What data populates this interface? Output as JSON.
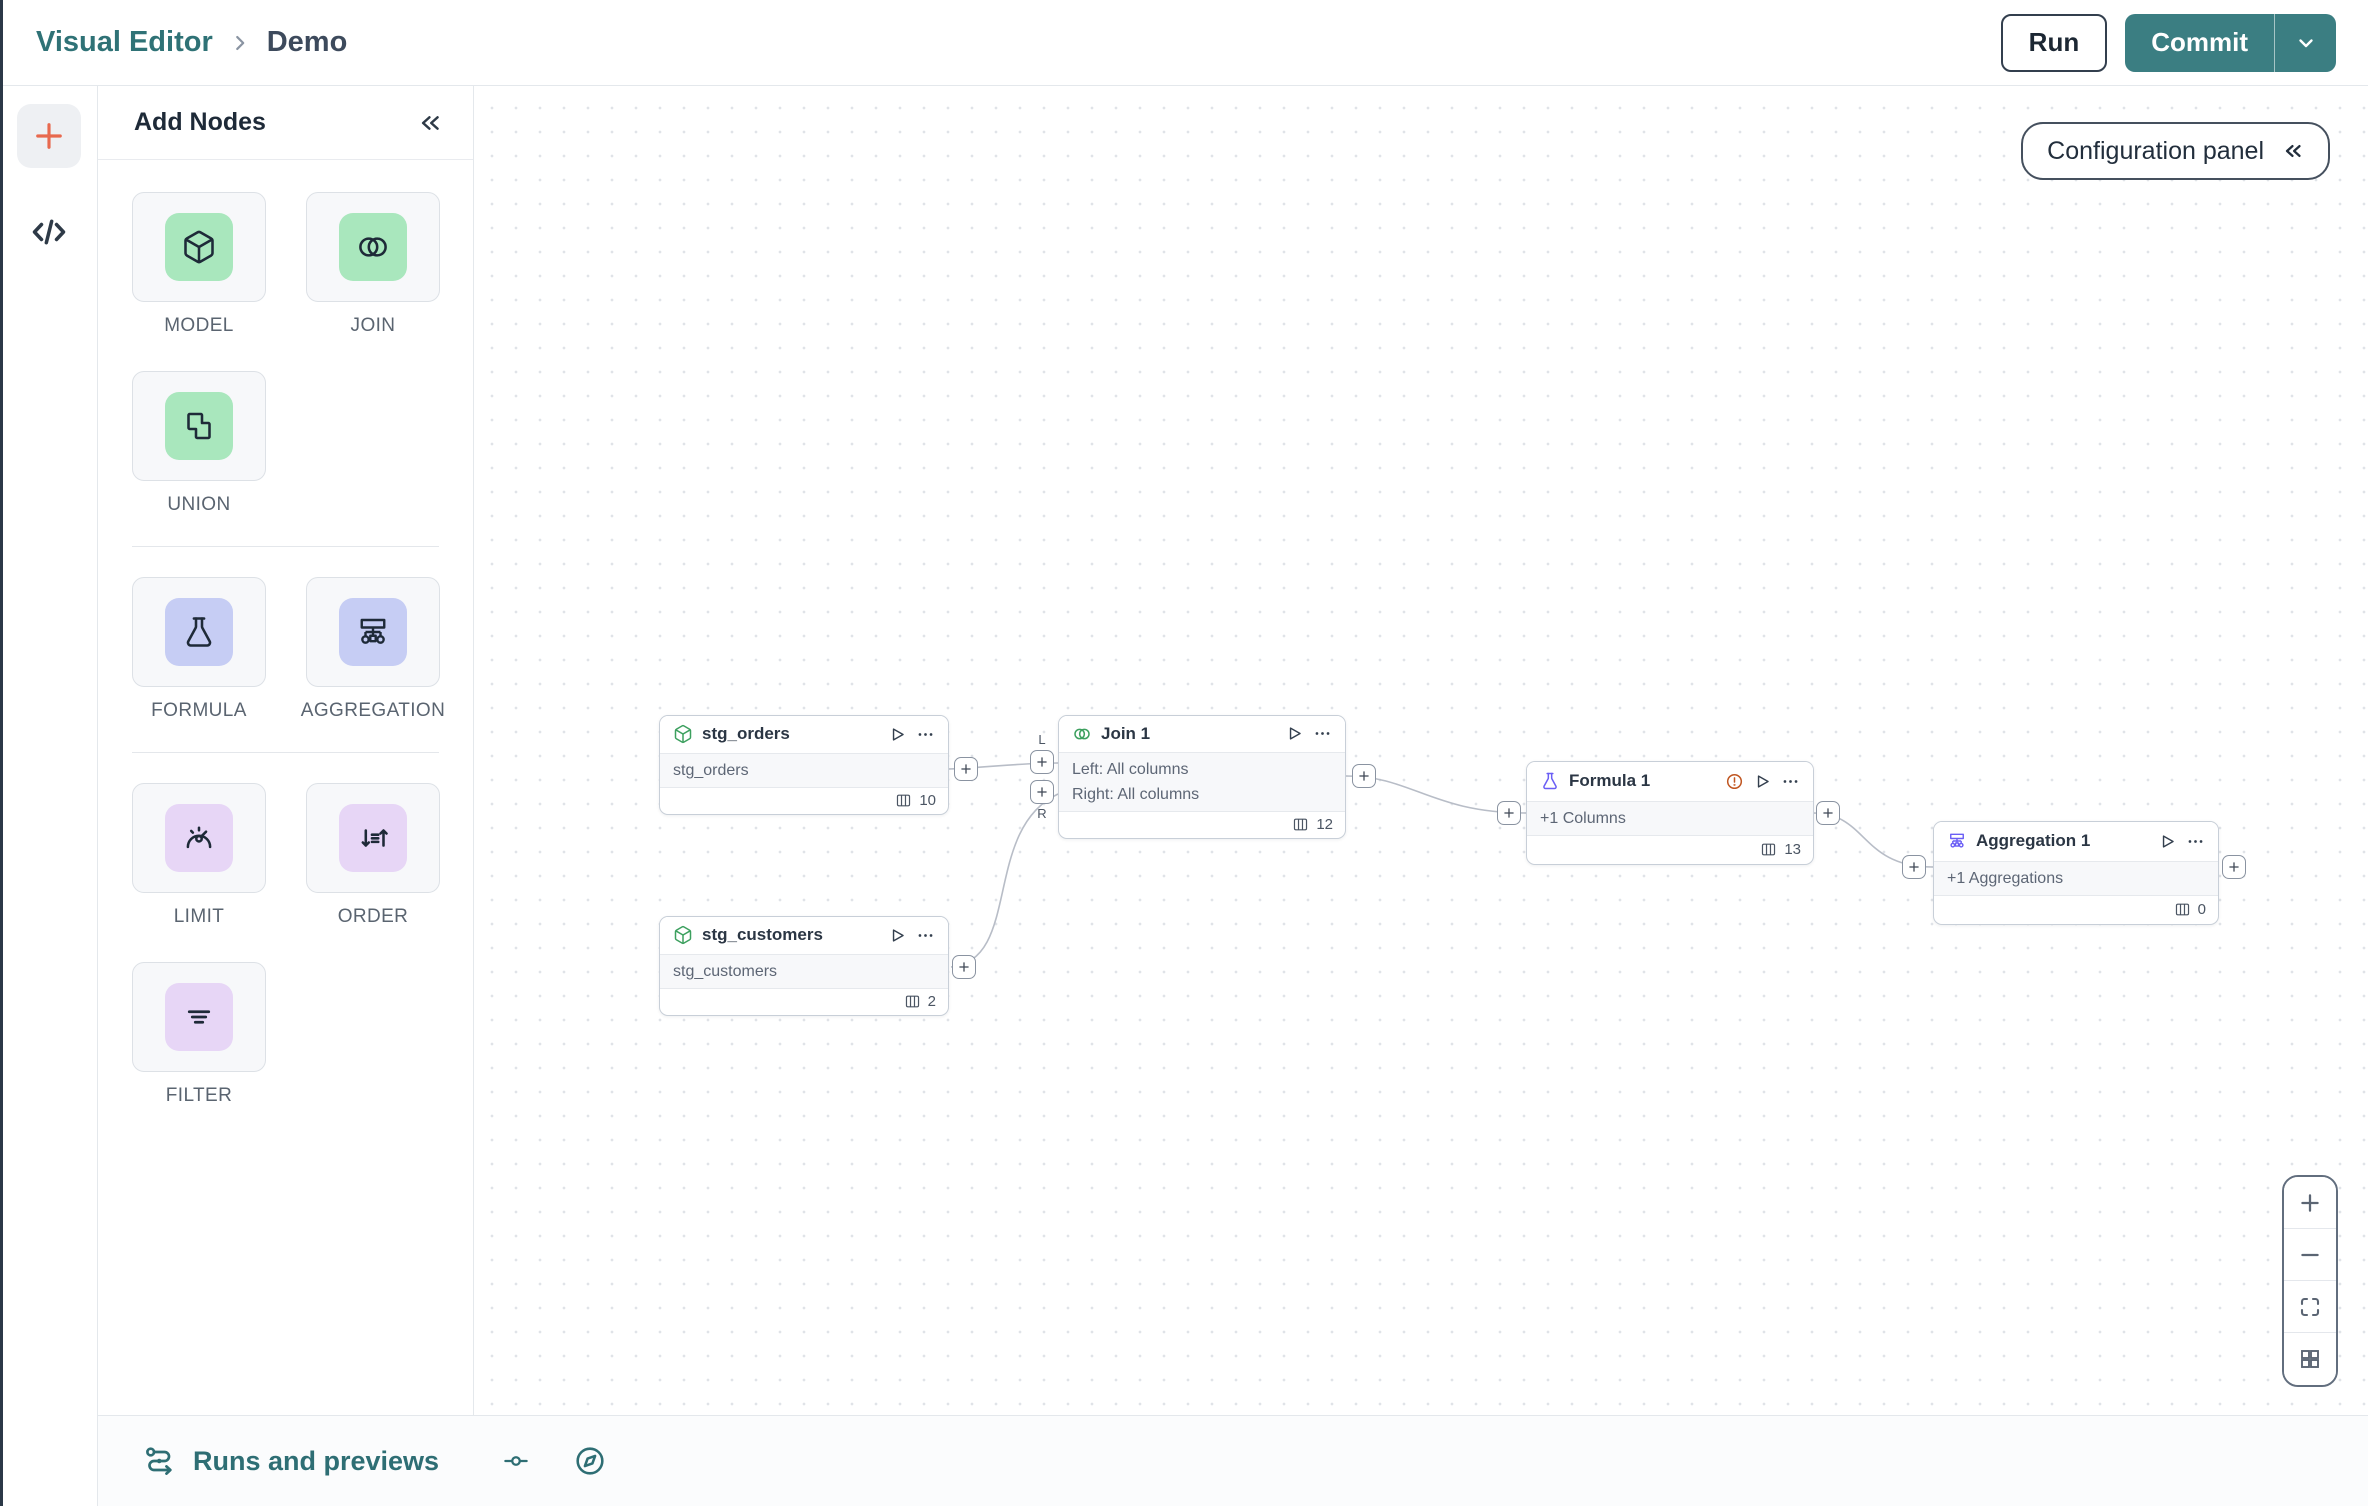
{
  "header": {
    "app_title": "Visual Editor",
    "page_title": "Demo",
    "run_label": "Run",
    "commit_label": "Commit"
  },
  "palette": {
    "title": "Add Nodes",
    "items": [
      {
        "label": "MODEL",
        "icon": "cube-icon"
      },
      {
        "label": "JOIN",
        "icon": "venn-icon"
      },
      {
        "label": "UNION",
        "icon": "union-shapes-icon"
      },
      {
        "label": "FORMULA",
        "icon": "flask-icon"
      },
      {
        "label": "AGGREGATION",
        "icon": "hierarchy-icon"
      },
      {
        "label": "LIMIT",
        "icon": "gauge-icon"
      },
      {
        "label": "ORDER",
        "icon": "sort-arrows-icon"
      },
      {
        "label": "FILTER",
        "icon": "filter-lines-icon"
      }
    ]
  },
  "canvas": {
    "config_panel_label": "Configuration panel",
    "join_inputs": {
      "left": "L",
      "right": "R"
    },
    "nodes": [
      {
        "title": "stg_orders",
        "subtitle": "stg_orders",
        "columns": "10"
      },
      {
        "title": "stg_customers",
        "subtitle": "stg_customers",
        "columns": "2"
      },
      {
        "title": "Join 1",
        "left_line": "Left: All columns",
        "right_line": "Right: All columns",
        "columns": "12"
      },
      {
        "title": "Formula 1",
        "subtitle": "+1 Columns",
        "columns": "13"
      },
      {
        "title": "Aggregation 1",
        "subtitle": "+1 Aggregations",
        "columns": "0"
      }
    ]
  },
  "bottom_bar": {
    "runs_label": "Runs and previews"
  },
  "colors": {
    "teal_text": "#2f7276",
    "commit_button": "#3b7e82",
    "coral_plus": "#e8694e",
    "node_green": "#3da05f",
    "node_purple": "#6a5ef5",
    "palette_green_bg": "#a9e7bd",
    "palette_lavender_bg": "#c6cdf4",
    "palette_purple_bg": "#e7d6f6",
    "warning": "#c05621",
    "edge_line": "#b8bdc7"
  }
}
